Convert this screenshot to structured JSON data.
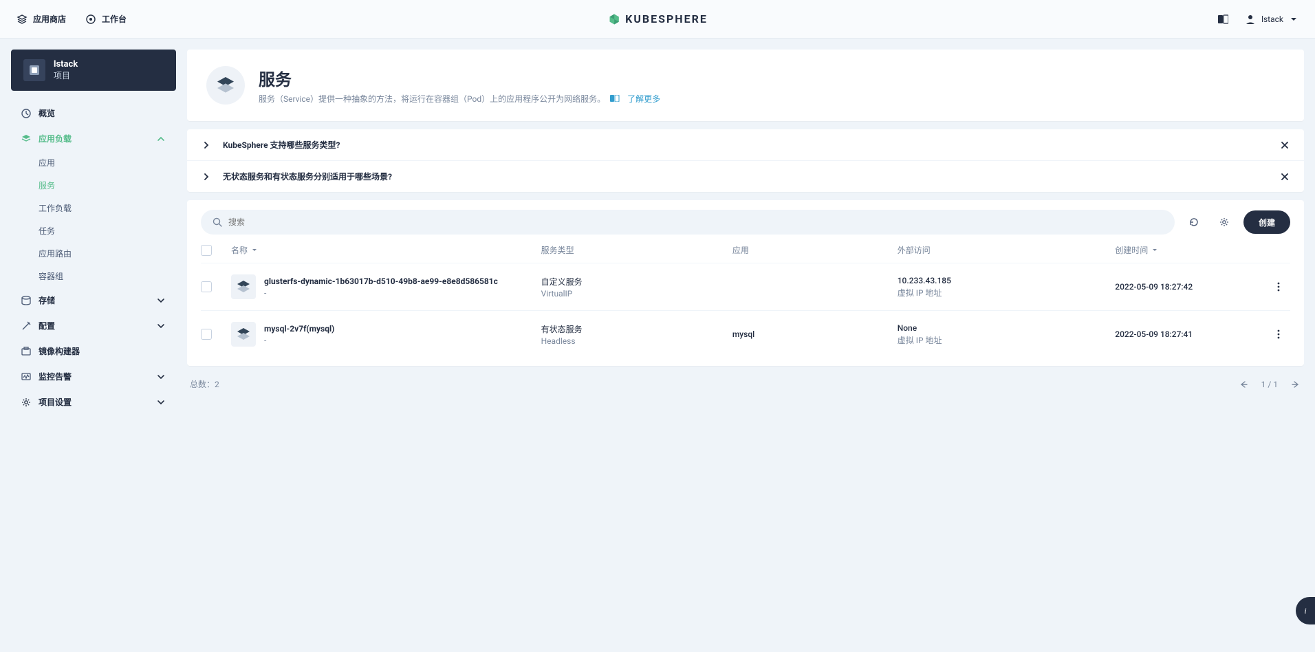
{
  "topnav": {
    "app_store": "应用商店",
    "workbench": "工作台",
    "logo_text": "KUBESPHERE",
    "user": "lstack"
  },
  "sidebar": {
    "project_name": "lstack",
    "project_sub": "项目",
    "items": {
      "overview": "概览",
      "workloads": "应用负载",
      "storage": "存储",
      "config": "配置",
      "image_builder": "镜像构建器",
      "monitoring": "监控告警",
      "project_settings": "项目设置"
    },
    "workload_sub": {
      "apps": "应用",
      "services": "服务",
      "workloads": "工作负载",
      "jobs": "任务",
      "routes": "应用路由",
      "pods": "容器组"
    }
  },
  "header": {
    "title": "服务",
    "desc": "服务（Service）提供一种抽象的方法，将运行在容器组（Pod）上的应用程序公开为网络服务。",
    "learn_more": "了解更多"
  },
  "faq": {
    "q1": "KubeSphere 支持哪些服务类型?",
    "q2": "无状态服务和有状态服务分别适用于哪些场景?"
  },
  "toolbar": {
    "search_placeholder": "搜索",
    "create": "创建"
  },
  "table": {
    "columns": {
      "name": "名称",
      "type": "服务类型",
      "app": "应用",
      "external": "外部访问",
      "created": "创建时间"
    },
    "rows": [
      {
        "name": "glusterfs-dynamic-1b63017b-d510-49b8-ae99-e8e8d586581c",
        "name_sub": "-",
        "type": "自定义服务",
        "type_sub": "VirtualIP",
        "app": "",
        "external": "10.233.43.185",
        "external_sub": "虚拟 IP 地址",
        "created": "2022-05-09 18:27:42"
      },
      {
        "name": "mysql-2v7f(mysql)",
        "name_sub": "-",
        "type": "有状态服务",
        "type_sub": "Headless",
        "app": "mysql",
        "external": "None",
        "external_sub": "虚拟 IP 地址",
        "created": "2022-05-09 18:27:41"
      }
    ]
  },
  "footer": {
    "total_prefix": "总数：",
    "total": "2",
    "page": "1 / 1"
  }
}
